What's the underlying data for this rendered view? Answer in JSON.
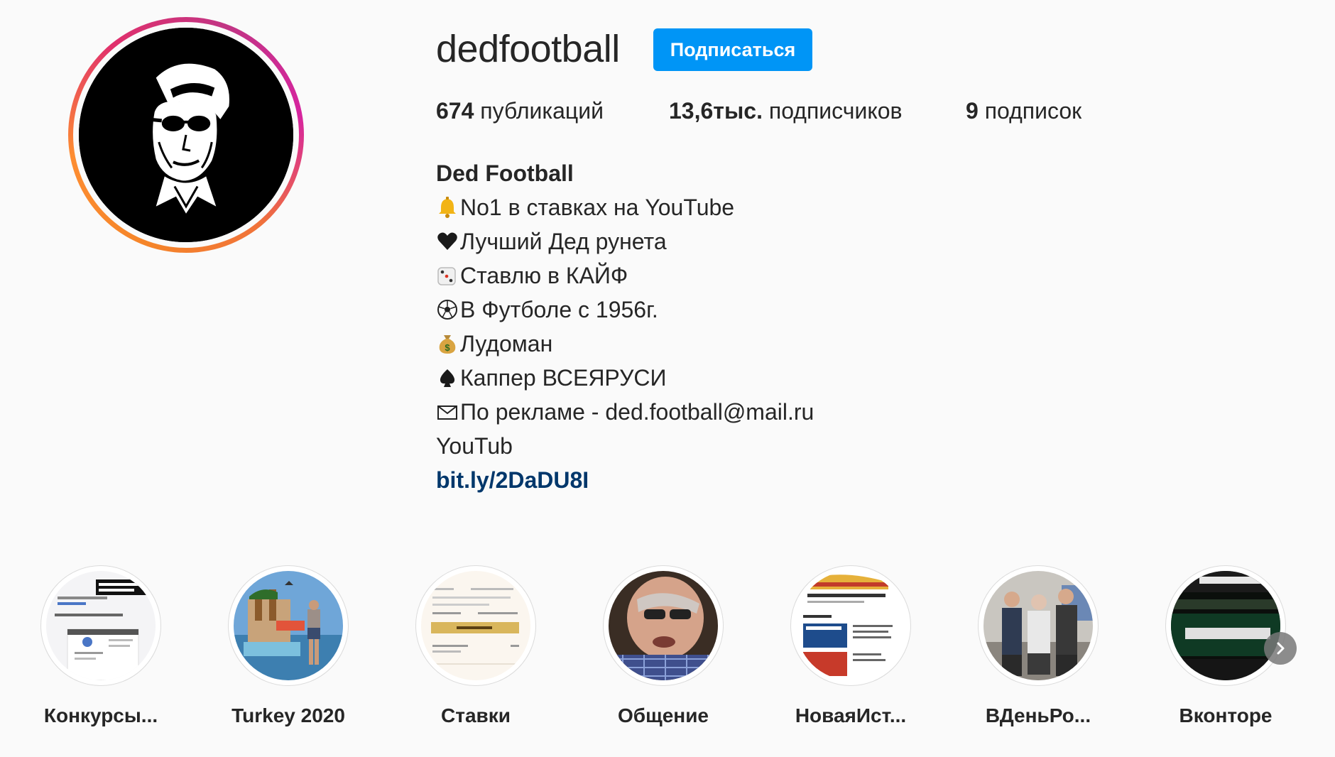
{
  "profile": {
    "username": "dedfootball",
    "follow_label": "Подписаться",
    "stats": {
      "posts_count": "674",
      "posts_label": " публикаций",
      "followers_count": "13,6тыс.",
      "followers_label": " подписчиков",
      "following_count": "9",
      "following_label": " подписок"
    }
  },
  "bio": {
    "name": "Ded Football",
    "lines": [
      {
        "icon": "bell-icon",
        "text": "No1 в ставках на YouTube"
      },
      {
        "icon": "heart-icon",
        "text": "Лучший Дед рунета"
      },
      {
        "icon": "dice-icon",
        "text": "Ставлю в КАЙФ"
      },
      {
        "icon": "soccer-ball-icon",
        "text": "В Футболе с 1956г."
      },
      {
        "icon": "money-bag-icon",
        "text": "Лудоман"
      },
      {
        "icon": "spade-icon",
        "text": "Каппер ВСЕЯРУСИ"
      },
      {
        "icon": "envelope-icon",
        "text": "По рекламе - ded.football@mail.ru"
      }
    ],
    "youtube_text": "YouTub",
    "link": "bit.ly/2DaDU8I"
  },
  "highlights": [
    {
      "label": "Конкурсы..."
    },
    {
      "label": "Turkey 2020"
    },
    {
      "label": "Ставки"
    },
    {
      "label": "Общение"
    },
    {
      "label": "НоваяИст..."
    },
    {
      "label": "ВДеньРо..."
    },
    {
      "label": "Вконторе"
    }
  ],
  "colors": {
    "follow_button": "#0095f6",
    "link": "#00376b",
    "background": "#fafafa"
  }
}
